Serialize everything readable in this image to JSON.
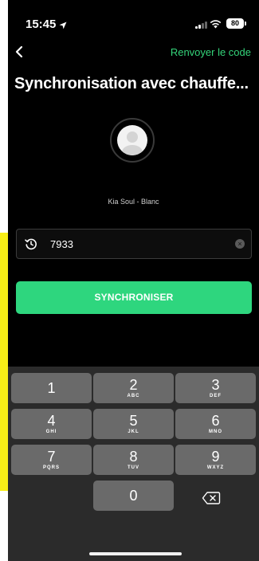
{
  "status_bar": {
    "time": "15:45",
    "battery": "80"
  },
  "nav": {
    "back_icon": "chevron-left-icon",
    "resend_label": "Renvoyer le code"
  },
  "page": {
    "title": "Synchronisation avec chauffe..."
  },
  "vehicle": {
    "label": "Kia Soul - Blanc"
  },
  "code_input": {
    "value": "7933"
  },
  "sync_button": {
    "label": "SYNCHRONISER"
  },
  "keypad": {
    "keys": [
      {
        "num": "1",
        "letters": ""
      },
      {
        "num": "2",
        "letters": "ABC"
      },
      {
        "num": "3",
        "letters": "DEF"
      },
      {
        "num": "4",
        "letters": "GHI"
      },
      {
        "num": "5",
        "letters": "JKL"
      },
      {
        "num": "6",
        "letters": "MNO"
      },
      {
        "num": "7",
        "letters": "PQRS"
      },
      {
        "num": "8",
        "letters": "TUV"
      },
      {
        "num": "9",
        "letters": "WXYZ"
      },
      {
        "num": "0",
        "letters": ""
      }
    ]
  },
  "colors": {
    "accent_green": "#2ed67e",
    "background": "#000000",
    "keypad_bg": "#2b2b2b",
    "key_bg": "#6a6a6a",
    "highlight_yellow": "#f7ee17"
  }
}
